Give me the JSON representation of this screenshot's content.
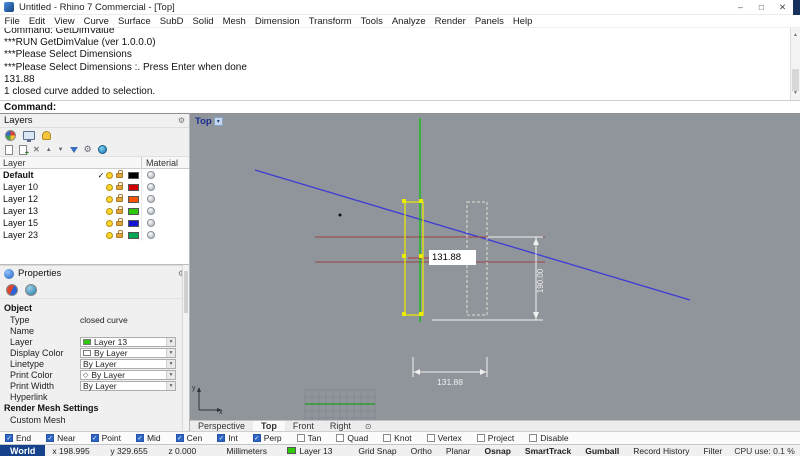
{
  "window": {
    "title": "Untitled - Rhino 7 Commercial - [Top]",
    "controls": {
      "minimize": "–",
      "maximize": "□",
      "close": "✕"
    }
  },
  "menu": {
    "items": [
      "File",
      "Edit",
      "View",
      "Curve",
      "Surface",
      "SubD",
      "Solid",
      "Mesh",
      "Dimension",
      "Transform",
      "Tools",
      "Analyze",
      "Render",
      "Panels",
      "Help"
    ]
  },
  "command_area": {
    "history": [
      "Command: GetDimValue",
      "***RUN GetDimValue (ver 1.0.0.0)",
      "***Please Select Dimensions",
      "***Please Select Dimensions :. Press Enter when done",
      "131.88",
      "1 closed curve added to selection."
    ],
    "prompt": "Command:"
  },
  "layers_panel": {
    "title": "Layers",
    "columns": {
      "layer": "Layer",
      "material": "Material"
    },
    "rows": [
      {
        "name": "Default",
        "current": true,
        "color": "#000000"
      },
      {
        "name": "Layer 10",
        "current": false,
        "color": "#d40000"
      },
      {
        "name": "Layer 12",
        "current": false,
        "color": "#ff5500"
      },
      {
        "name": "Layer 13",
        "current": false,
        "color": "#2fc90c"
      },
      {
        "name": "Layer 15",
        "current": false,
        "color": "#1414d4"
      },
      {
        "name": "Layer 23",
        "current": false,
        "color": "#00a651"
      }
    ]
  },
  "properties_panel": {
    "title": "Properties",
    "object_section": {
      "title": "Object",
      "type_label": "Type",
      "type_value": "closed curve",
      "name_label": "Name",
      "name_value": "",
      "layer_label": "Layer",
      "layer_value": "Layer 13",
      "layer_color": "#2fc90c",
      "display_color_label": "Display Color",
      "display_color_value": "By Layer",
      "display_color_swatch": "#ffffff",
      "linetype_label": "Linetype",
      "linetype_value": "By Layer",
      "print_color_label": "Print Color",
      "print_color_value": "By Layer",
      "print_width_label": "Print Width",
      "print_width_value": "By Layer",
      "hyperlink_label": "Hyperlink",
      "hyperlink_value": ""
    },
    "render_mesh_section": {
      "title": "Render Mesh Settings",
      "custom_mesh_label": "Custom Mesh"
    }
  },
  "viewport": {
    "label": "Top",
    "dim_input_value": "131.88",
    "dim_vertical": "190.00",
    "dim_horizontal": "131.88",
    "axis": {
      "x": "x",
      "y": "y"
    },
    "colors": {
      "background": "#90959c",
      "curve_blue": "#3c3cd2",
      "curve_red": "#9a4444",
      "curve_green": "#00c400",
      "selection_yellow": "#eded00",
      "dimension_white": "#efefef"
    }
  },
  "viewport_tabs": {
    "tabs": [
      {
        "label": "Perspective",
        "active": false
      },
      {
        "label": "Top",
        "active": true
      },
      {
        "label": "Front",
        "active": false
      },
      {
        "label": "Right",
        "active": false
      }
    ]
  },
  "osnap": {
    "items": [
      {
        "label": "End",
        "checked": true
      },
      {
        "label": "Near",
        "checked": true
      },
      {
        "label": "Point",
        "checked": true
      },
      {
        "label": "Mid",
        "checked": true
      },
      {
        "label": "Cen",
        "checked": true
      },
      {
        "label": "Int",
        "checked": true
      },
      {
        "label": "Perp",
        "checked": true
      },
      {
        "label": "Tan",
        "checked": false
      },
      {
        "label": "Quad",
        "checked": false
      },
      {
        "label": "Knot",
        "checked": false
      },
      {
        "label": "Vertex",
        "checked": false
      },
      {
        "label": "Project",
        "checked": false
      },
      {
        "label": "Disable",
        "checked": false
      }
    ]
  },
  "status_bar": {
    "cplane": "World",
    "coords": {
      "x": "x 198.995",
      "y": "y 329.655",
      "z": "z 0.000"
    },
    "units": "Millimeters",
    "layer": {
      "name": "Layer 13",
      "color": "#2fc90c"
    },
    "toggles": [
      {
        "label": "Grid Snap",
        "active": false
      },
      {
        "label": "Ortho",
        "active": false
      },
      {
        "label": "Planar",
        "active": false
      },
      {
        "label": "Osnap",
        "active": true
      },
      {
        "label": "SmartTrack",
        "active": true
      },
      {
        "label": "Gumball",
        "active": true
      },
      {
        "label": "Record History",
        "active": false
      },
      {
        "label": "Filter",
        "active": false
      }
    ],
    "cpu": "CPU use: 0.1 %"
  },
  "icons": {
    "check": "✓",
    "dropdown": "▾",
    "combo_arrow": "▾",
    "gear": "⚙",
    "target": "⊙",
    "diamond": "◇",
    "delete": "✕",
    "up_arrow": "▲",
    "down_arrow": "▼",
    "scroll_up": "▲",
    "scroll_down": "▼"
  }
}
